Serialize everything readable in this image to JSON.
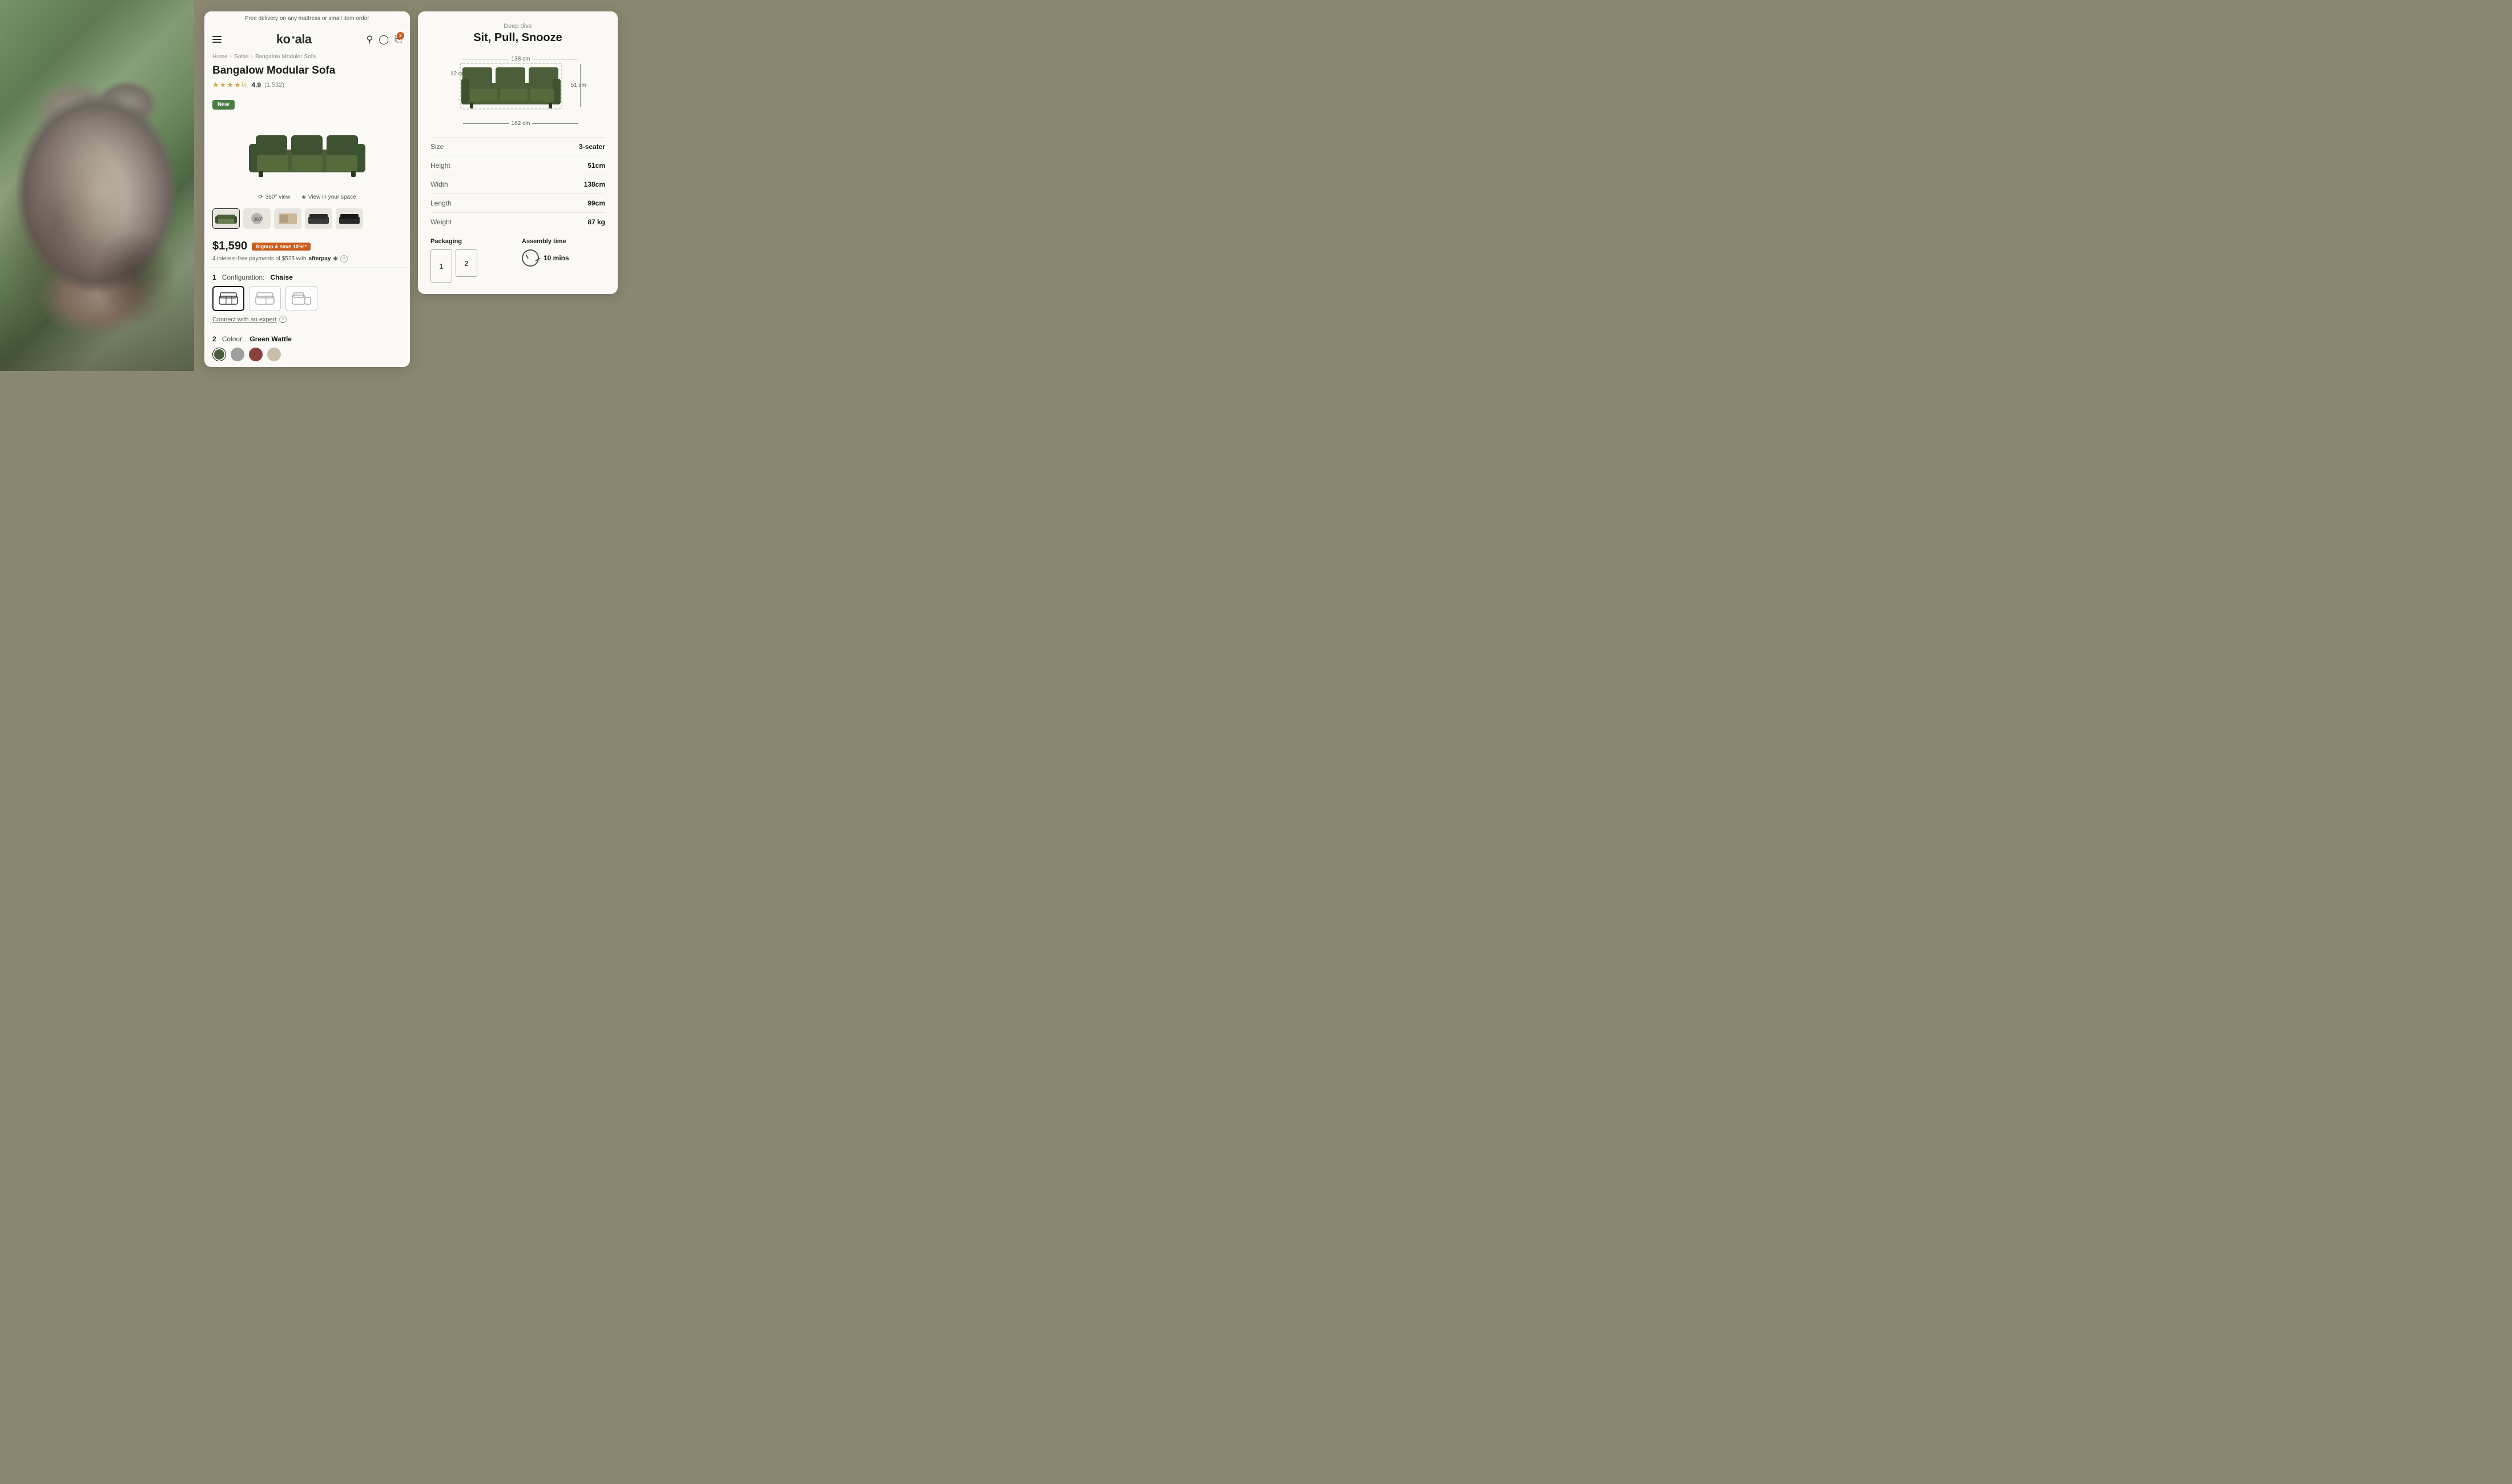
{
  "promo": {
    "text": "Free delivery on any mattress or small item order"
  },
  "header": {
    "logo": "ko·ala",
    "menu_label": "Menu",
    "cart_count": "2"
  },
  "breadcrumb": {
    "home": "Home",
    "sofas": "Sofas",
    "product": "Bangalow Modular Sofa"
  },
  "product": {
    "title": "Bangalow Modular Sofa",
    "rating": "4.9",
    "review_count": "(1,532)",
    "badge": "New",
    "price": "$1,590",
    "signup_badge": "Signup & save 10%!*",
    "afterpay_text": "4 interest-free payments of $525 with",
    "afterpay_brand": "afterpay",
    "view_360": "360° view",
    "view_space": "View in your space",
    "config_step": "1",
    "config_label": "Configuration:",
    "config_value": "Chaise",
    "connect_link": "Connect with an expert",
    "colour_step": "2",
    "colour_label": "Colour:",
    "colour_value": "Green Wattle"
  },
  "dimensions": {
    "subtitle": "Deep dive",
    "title": "Sit, Pull, Snooze",
    "dim_top": "138 cm",
    "dim_left": "12 cm",
    "dim_right": "51 cm",
    "dim_bottom": "162 cm",
    "specs": [
      {
        "label": "Size",
        "value": "3-seater"
      },
      {
        "label": "Height",
        "value": "51cm"
      },
      {
        "label": "Width",
        "value": "138cm"
      },
      {
        "label": "Length",
        "value": "99cm"
      },
      {
        "label": "Weight",
        "value": "87 kg"
      }
    ],
    "packaging_label": "Packaging",
    "assembly_label": "Assembly time",
    "assembly_time": "10 mins",
    "boxes": [
      "1",
      "2"
    ]
  },
  "colors": {
    "green_wattle": "#4a5e3a",
    "grey": "#9e9e9e",
    "terracotta": "#8b4040",
    "cream": "#c8bfaa",
    "background": "#8a8770",
    "card_bg": "#faf9f6"
  }
}
